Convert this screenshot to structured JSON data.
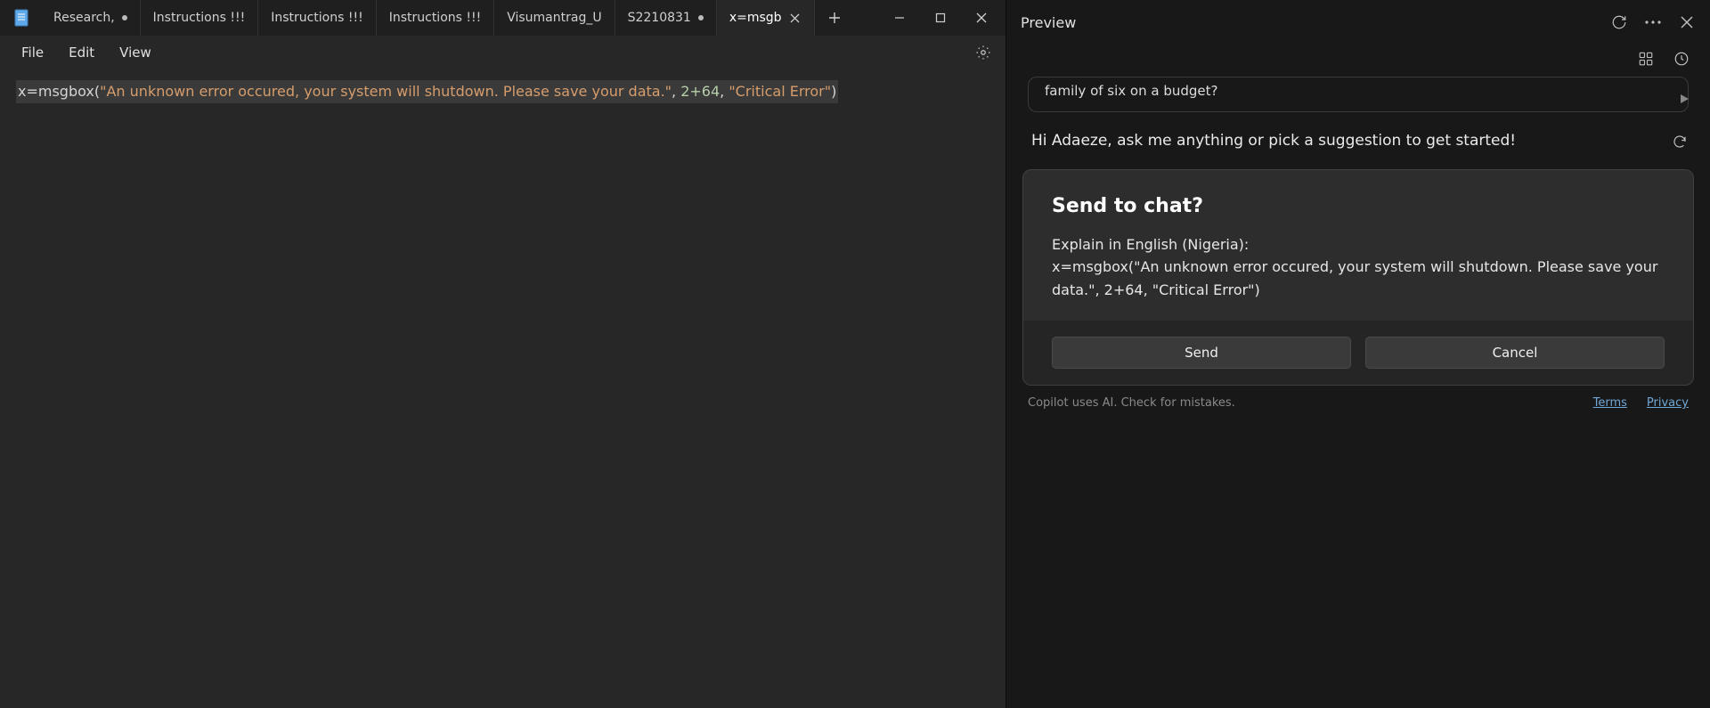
{
  "tabs": [
    {
      "label": "Research,",
      "modified": true,
      "active": false
    },
    {
      "label": "Instructions !!!",
      "modified": false,
      "active": false
    },
    {
      "label": "Instructions !!!",
      "modified": false,
      "active": false
    },
    {
      "label": "Instructions !!!",
      "modified": false,
      "active": false
    },
    {
      "label": "Visumantrag_U",
      "modified": false,
      "active": false
    },
    {
      "label": "S2210831",
      "modified": true,
      "active": false
    },
    {
      "label": "x=msgb",
      "modified": false,
      "active": true,
      "closeable": true
    }
  ],
  "menus": {
    "file": "File",
    "edit": "Edit",
    "view": "View"
  },
  "editor": {
    "line_prefix": "x=msgbox(",
    "line_string": "\"An unknown error occured, your system will shutdown. Please save your data.\"",
    "line_mid": ", ",
    "line_numexpr": "2+64",
    "line_mid2": ", ",
    "line_string2": "\"Critical Error\"",
    "line_suffix": ")"
  },
  "sidebar": {
    "title": "Preview",
    "suggestion_text": "family of six on a budget?",
    "greeting": "Hi Adaeze, ask me anything or pick a suggestion to get started!",
    "dialog": {
      "title": "Send to chat?",
      "body_line1": "Explain in English (Nigeria):",
      "body_line2": "x=msgbox(\"An unknown error occured, your system will shutdown. Please save your data.\", 2+64, \"Critical Error\")",
      "send_label": "Send",
      "cancel_label": "Cancel"
    },
    "footer_note": "Copilot uses AI. Check for mistakes.",
    "footer_terms": "Terms",
    "footer_privacy": "Privacy"
  }
}
